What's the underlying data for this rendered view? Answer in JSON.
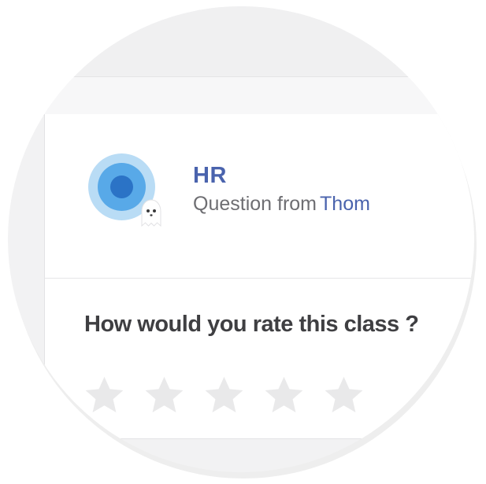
{
  "question_card": {
    "title": "HR",
    "subtitle_prefix": "Question from",
    "author_name": "Thom",
    "avatar_icon": "concentric-circle-avatar-icon",
    "badge_icon": "ghost-icon",
    "colors": {
      "accent": "#4a63ad",
      "avatar_outer": "#b9dcf5",
      "avatar_middle": "#58a9e8",
      "avatar_inner": "#2b73c6"
    }
  },
  "rating": {
    "question": "How would you rate this class ?",
    "max_stars": 5,
    "selected_stars": 0,
    "star_icon": "star-icon",
    "star_color": "#e9e9ea"
  }
}
